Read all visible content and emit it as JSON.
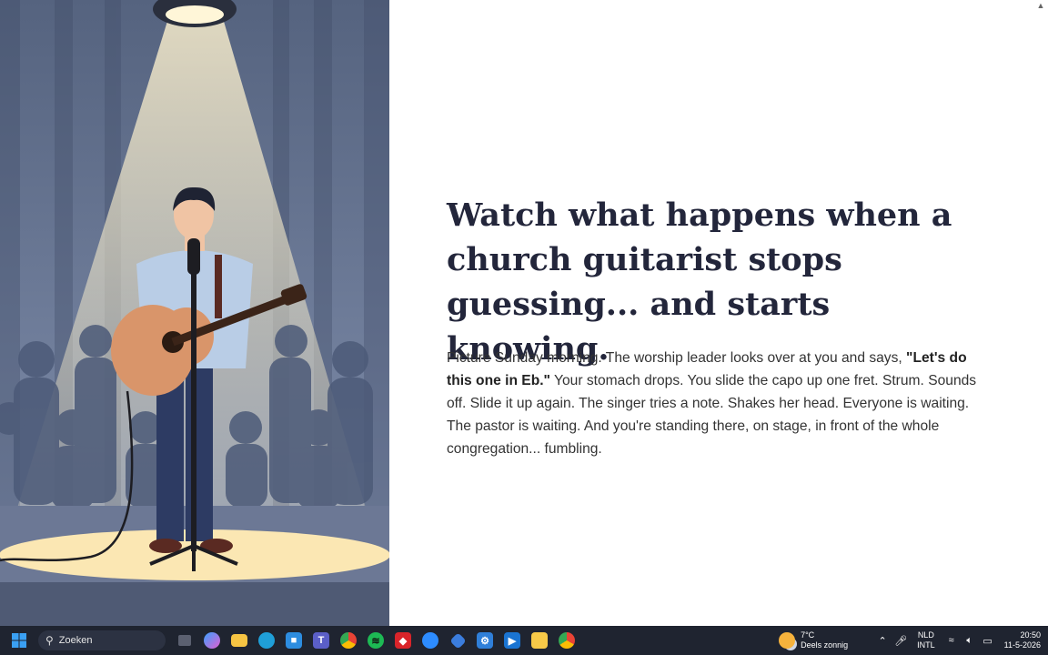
{
  "headline": "Watch what happens when a church guitarist stops guessing... and starts knowing.",
  "intro": {
    "before": "Picture Sunday morning. The worship leader looks over at you and says, ",
    "bold": "\"Let's do this one in Eb.\"",
    "after": " Your stomach drops. You slide the capo up one fret. Strum. Sounds off. Slide it up again. The singer tries a note. Shakes her head. Everyone is waiting. The pastor is waiting. And you're standing there, on stage, in front of the whole congregation... fumbling."
  },
  "taskbar": {
    "search_placeholder": "Zoeken",
    "weather_temp": "7°C",
    "weather_desc": "Deels zonnig",
    "lang_top": "NLD",
    "lang_bottom": "INTL",
    "time": "20:50",
    "date": "11-5-2026"
  },
  "colors": {
    "headline": "#23263b",
    "body_text": "#333333",
    "taskbar": "#1f2430",
    "illustration_bg": "#5d6b8c"
  }
}
